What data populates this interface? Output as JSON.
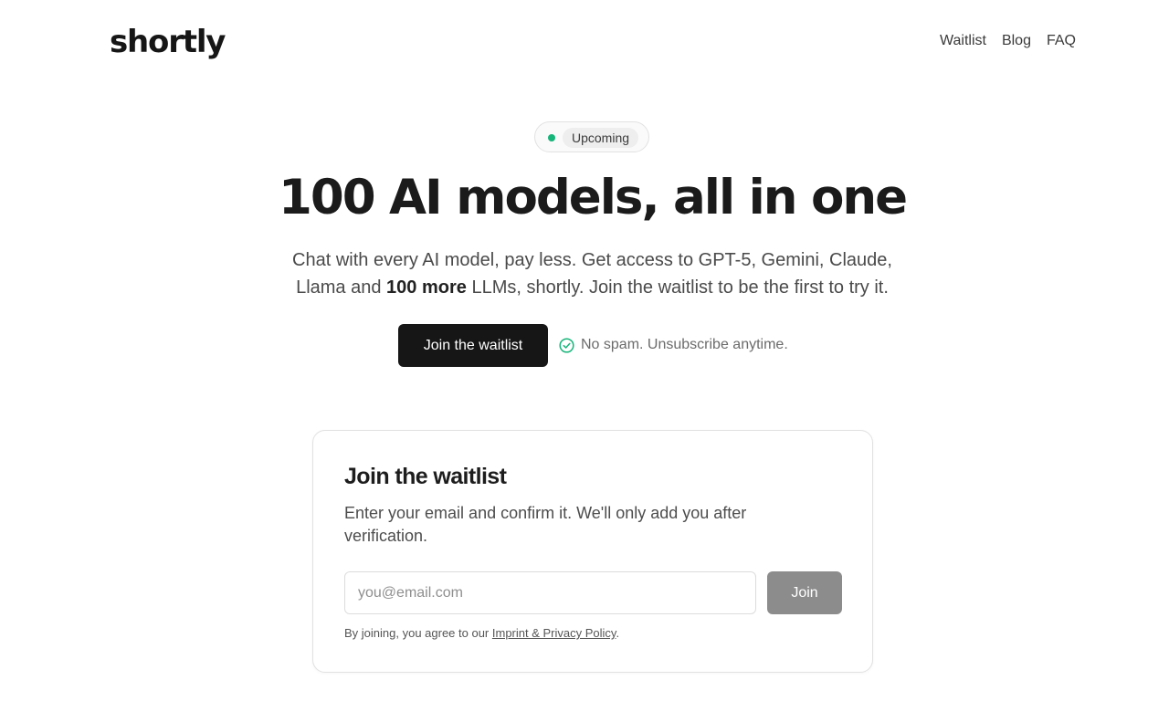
{
  "brand": {
    "name": "shortly"
  },
  "nav": {
    "items": [
      "Waitlist",
      "Blog",
      "FAQ"
    ]
  },
  "badge": {
    "label": "Upcoming",
    "dot_color": "#16b57a"
  },
  "hero": {
    "title": "100 AI models, all in one",
    "subtitle_line1": "Chat with every AI model, pay less. Get access to GPT-5, Gemini, Claude,",
    "subtitle_line2_pre": "Llama and ",
    "subtitle_line2_bold": "100 more",
    "subtitle_line2_post": " LLMs, shortly. Join the waitlist to be the first to try it.",
    "cta_label": "Join the waitlist",
    "nospam_text": "No spam. Unsubscribe anytime.",
    "nospam_icon": "check-circle-icon"
  },
  "waitlist_card": {
    "title": "Join the waitlist",
    "description": "Enter your email and confirm it. We'll only add you after verification.",
    "email_placeholder": "you@email.com",
    "email_value": "",
    "join_label": "Join",
    "legal_prefix": "By joining, you agree to our ",
    "legal_link": "Imprint & Privacy Policy",
    "legal_suffix": "."
  },
  "colors": {
    "accent_green": "#16b57a",
    "cta_bg": "#161616",
    "join_bg": "#8c8c8c"
  }
}
